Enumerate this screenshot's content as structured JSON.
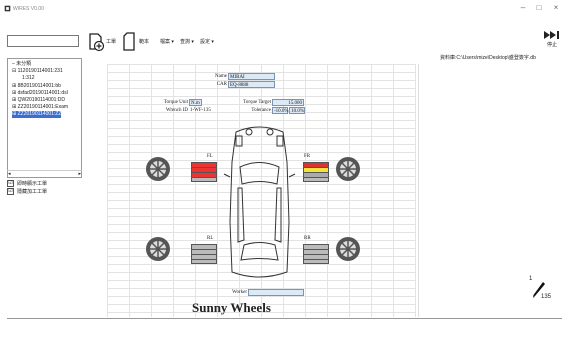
{
  "window": {
    "title": "WIRES V0.00",
    "minimize": "–",
    "maximize": "□",
    "close": "×"
  },
  "toolbar": {
    "search_value": "",
    "btn1_label": "工單",
    "btn2_label": "範本",
    "menu1": "檔案 ▾",
    "menu2": "查詢 ▾",
    "menu3": "設定 ▾",
    "stop_label": "停止"
  },
  "path_bar": "資料庫:C:\\Users\\mize\\Desktop\\盛登簽字.db",
  "tree": {
    "items": [
      {
        "label": "未分類",
        "selected": false
      },
      {
        "label": "1120190114001:231",
        "selected": false
      },
      {
        "label": "1:312",
        "selected": false
      },
      {
        "label": "8B20190114001:bb",
        "selected": false
      },
      {
        "label": "dsfad20190114001:dsl",
        "selected": false
      },
      {
        "label": "QW20190114001:DD",
        "selected": false
      },
      {
        "label": "ZZ20190114001:Exam",
        "selected": false
      },
      {
        "label": "ZZ20190114001:ZZ",
        "selected": true
      }
    ]
  },
  "checkboxes": [
    {
      "label": "即時顯示工單",
      "checked": "☑"
    },
    {
      "label": "隱藏加工工單",
      "checked": "☑"
    }
  ],
  "sheet": {
    "name_label": "Name",
    "name_value": "MIRAI",
    "car_label": "CAR",
    "car_value": "EQ-8888",
    "torque_unit_label": "Torque Unit",
    "torque_unit_value": "N.m",
    "torque_target_label": "Torque Target",
    "torque_target_value": "15.000",
    "wrench_label": "Wrench ID",
    "wrench_value": "1-WF-135",
    "tolerance_label": "Tolerance",
    "tolerance_low": "-10.0%",
    "tolerance_high": "10.0%",
    "fl": "FL",
    "fr": "FR",
    "rl": "RL",
    "rr": "RR",
    "worker_label": "Worker",
    "worker_value": "",
    "brand": "Sunny Wheels"
  },
  "tyre_colors": {
    "fl": [
      "#e33",
      "#e33",
      "#e33",
      "#bbb"
    ],
    "fr": [
      "#d33",
      "#f3e33a",
      "#aaa",
      "#bbb"
    ],
    "rl": [
      "#bbb",
      "#bbb",
      "#bbb",
      "#bbb"
    ],
    "rr": [
      "#bbb",
      "#bbb",
      "#bbb",
      "#bbb"
    ]
  },
  "badge": {
    "top": "1",
    "bottom": "135"
  }
}
